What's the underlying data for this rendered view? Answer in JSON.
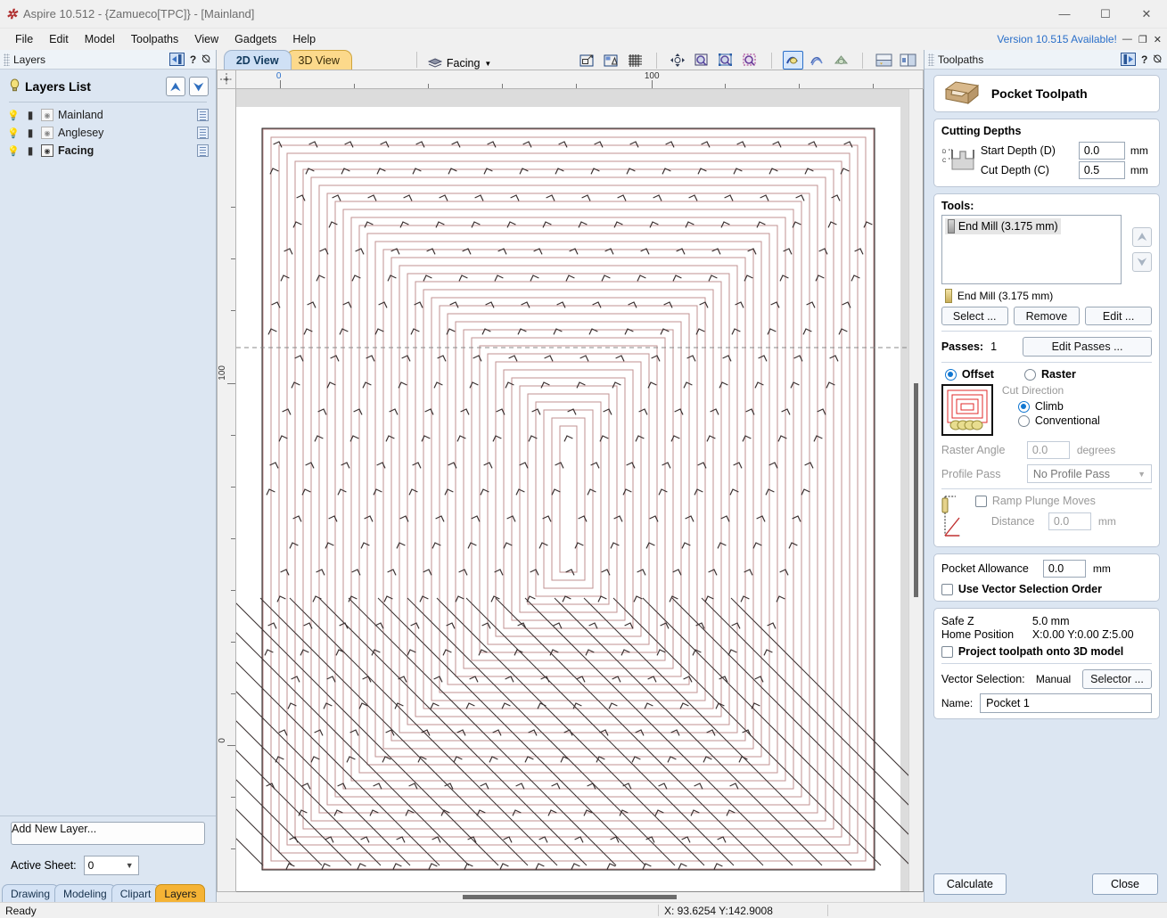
{
  "window": {
    "title": "Aspire 10.512 - {Zamueco[TPC]} - [Mainland]",
    "logo_icon": "aspire-flame-icon",
    "minimize": "—",
    "maximize": "☐",
    "close": "✕"
  },
  "menu": {
    "items": [
      "File",
      "Edit",
      "Model",
      "Toolpaths",
      "View",
      "Gadgets",
      "Help"
    ],
    "version_note": "Version 10.515 Available!",
    "doc_minimize": "—",
    "doc_restore": "❐",
    "doc_close": "✕"
  },
  "layers_panel": {
    "caption": "Layers",
    "caption_help": "?",
    "caption_pin": "⦰",
    "list_title": "Layers List",
    "items": [
      {
        "label": "Mainland",
        "active": false,
        "visible": false
      },
      {
        "label": "Anglesey",
        "active": false,
        "visible": false
      },
      {
        "label": "Facing",
        "active": true,
        "visible": true
      }
    ],
    "add_layer_button": "Add New Layer...",
    "active_sheet_label": "Active Sheet:",
    "active_sheet_value": "0",
    "tabs": [
      {
        "label": "Drawing",
        "active": false
      },
      {
        "label": "Modeling",
        "active": false
      },
      {
        "label": "Clipart",
        "active": false
      },
      {
        "label": "Layers",
        "active": true
      }
    ]
  },
  "view_bar": {
    "tabs": [
      {
        "label": "2D View",
        "active": true
      },
      {
        "label": "3D View",
        "active": false
      }
    ],
    "layer_selector": "Facing",
    "layer_caret": "▾",
    "icons": [
      "zoom-to-selection-icon",
      "zoom-to-drawing-icon",
      "toggle-grid-icon",
      "pan-icon",
      "zoom-extents-icon",
      "zoom-selection-icon",
      "zoom-box-icon",
      "toggle-toolpath-preview-icon",
      "toggle-toolpath-solid-icon",
      "toggle-3d-model-icon",
      "split-horizontal-icon",
      "split-vertical-icon"
    ]
  },
  "canvas": {
    "ruler_h_labels": [
      {
        "text": "0",
        "pos": 49
      },
      {
        "text": "100",
        "pos": 466
      }
    ],
    "ruler_v_labels": [
      {
        "text": "100",
        "pos": 315
      },
      {
        "text": "0",
        "pos": 730
      }
    ],
    "toolpath_color": "#c19292",
    "arrow_color": "#3a3030",
    "material_color": "#ffffff",
    "background_color": "#dcdcdc"
  },
  "toolpaths_panel": {
    "caption": "Toolpaths",
    "caption_help": "?",
    "caption_pin": "⦰",
    "header_title": "Pocket Toolpath",
    "header_icon": "pocket-toolpath-icon",
    "cutting_depths": {
      "title": "Cutting Depths",
      "icon": "depth-profile-icon",
      "start_depth_label": "Start Depth (D)",
      "start_depth_value": "0.0",
      "start_depth_unit": "mm",
      "cut_depth_label": "Cut Depth (C)",
      "cut_depth_value": "0.5",
      "cut_depth_unit": "mm"
    },
    "tools": {
      "title": "Tools:",
      "list": [
        "End Mill (3.175 mm)"
      ],
      "current_tool": "End Mill (3.175 mm)",
      "move_up_icon": "arrow-up-icon",
      "move_down_icon": "arrow-down-icon",
      "select_button": "Select ...",
      "remove_button": "Remove",
      "edit_button": "Edit ...",
      "passes_label": "Passes:",
      "passes_value": "1",
      "edit_passes_button": "Edit Passes ...",
      "strategy": {
        "offset_label": "Offset",
        "offset_selected": true,
        "raster_label": "Raster",
        "raster_selected": false,
        "preview_icon": "offset-pattern-icon"
      },
      "cut_direction": {
        "title": "Cut Direction",
        "climb_label": "Climb",
        "climb_selected": true,
        "conventional_label": "Conventional",
        "conventional_selected": false
      },
      "raster_angle_label": "Raster Angle",
      "raster_angle_value": "0.0",
      "raster_angle_unit": "degrees",
      "profile_pass_label": "Profile Pass",
      "profile_pass_value": "No Profile Pass",
      "ramp": {
        "icon": "ramp-plunge-icon",
        "checkbox_label": "Ramp Plunge Moves",
        "checked": false,
        "distance_label": "Distance",
        "distance_value": "0.0",
        "distance_unit": "mm"
      }
    },
    "allowance": {
      "label": "Pocket Allowance",
      "value": "0.0",
      "unit": "mm",
      "vector_order_label": "Use Vector Selection Order",
      "vector_order_checked": false
    },
    "position": {
      "safe_z_label": "Safe Z",
      "safe_z_value": "5.0 mm",
      "home_label": "Home Position",
      "home_value": "X:0.00 Y:0.00 Z:5.00",
      "project_label": "Project toolpath onto 3D model",
      "project_checked": false,
      "vector_selection_label": "Vector Selection:",
      "vector_selection_value": "Manual",
      "selector_button": "Selector ...",
      "name_label": "Name:",
      "name_value": "Pocket 1"
    },
    "calculate_button": "Calculate",
    "close_button": "Close"
  },
  "statusbar": {
    "ready": "Ready",
    "coords": "X: 93.6254 Y:142.9008"
  }
}
